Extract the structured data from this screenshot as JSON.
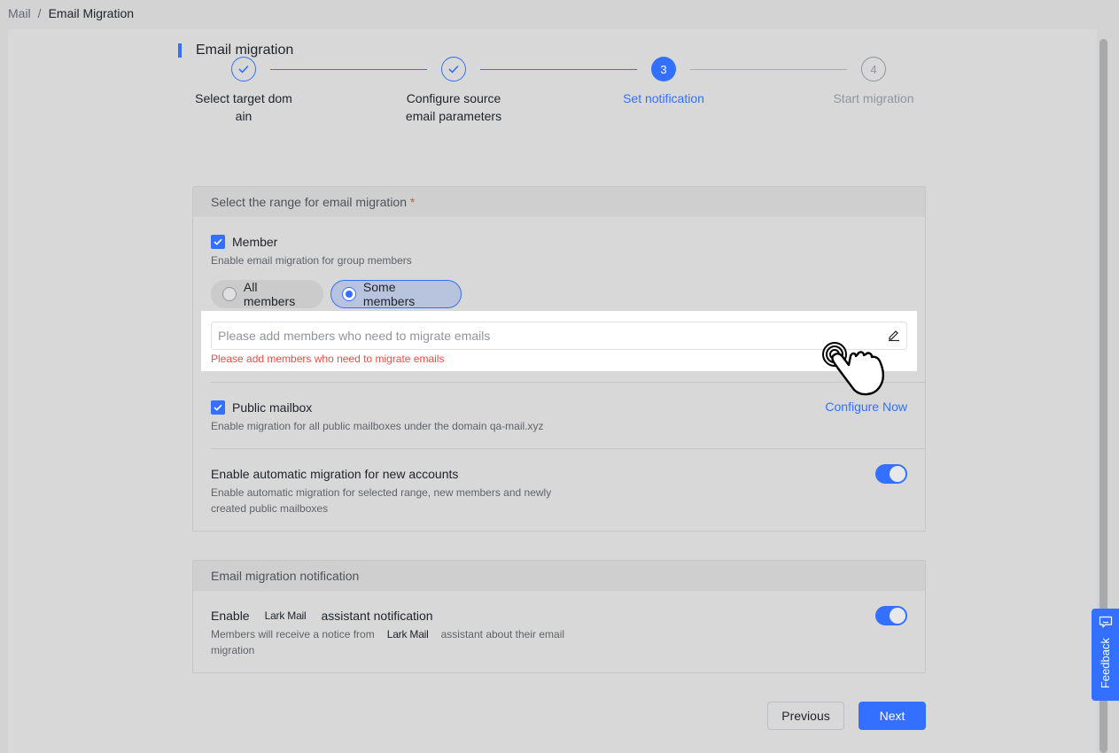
{
  "breadcrumb": {
    "root": "Mail",
    "sep": "/",
    "current": "Email Migration"
  },
  "page": {
    "title": "Email migration"
  },
  "steps": [
    {
      "number": "1",
      "label": "Select target dom ain",
      "status": "done"
    },
    {
      "number": "2",
      "label": "Configure source email parameters",
      "status": "done"
    },
    {
      "number": "3",
      "label": "Set notification",
      "status": "active"
    },
    {
      "number": "4",
      "label": "Start migration",
      "status": "pending"
    }
  ],
  "range": {
    "header": "Select the range for email migration",
    "required_mark": "*",
    "member": {
      "label": "Member",
      "checked": true,
      "desc": "Enable email migration for group members",
      "options": [
        "All members",
        "Some members"
      ],
      "selected": "Some members",
      "input_placeholder": "Please add members who need to migrate emails",
      "error": "Please add members who need to migrate emails"
    },
    "public_mailbox": {
      "label": "Public mailbox",
      "checked": true,
      "desc": "Enable migration for all public mailboxes under the domain qa-mail.xyz",
      "link": "Configure Now"
    },
    "auto": {
      "title": "Enable automatic migration for new accounts",
      "desc": "Enable automatic migration for selected range, new members and newly created public mailboxes",
      "enabled": true
    }
  },
  "notification": {
    "header": "Email migration notification",
    "title_before": "Enable",
    "brand": "Lark Mail",
    "title_after": "assistant notification",
    "desc_before": "Members will receive a notice from",
    "desc_after": "assistant about their email migration",
    "enabled": true
  },
  "buttons": {
    "previous": "Previous",
    "next": "Next"
  },
  "feedback": {
    "label": "Feedback"
  },
  "colors": {
    "accent": "#3370ff",
    "error": "#f54a45"
  }
}
